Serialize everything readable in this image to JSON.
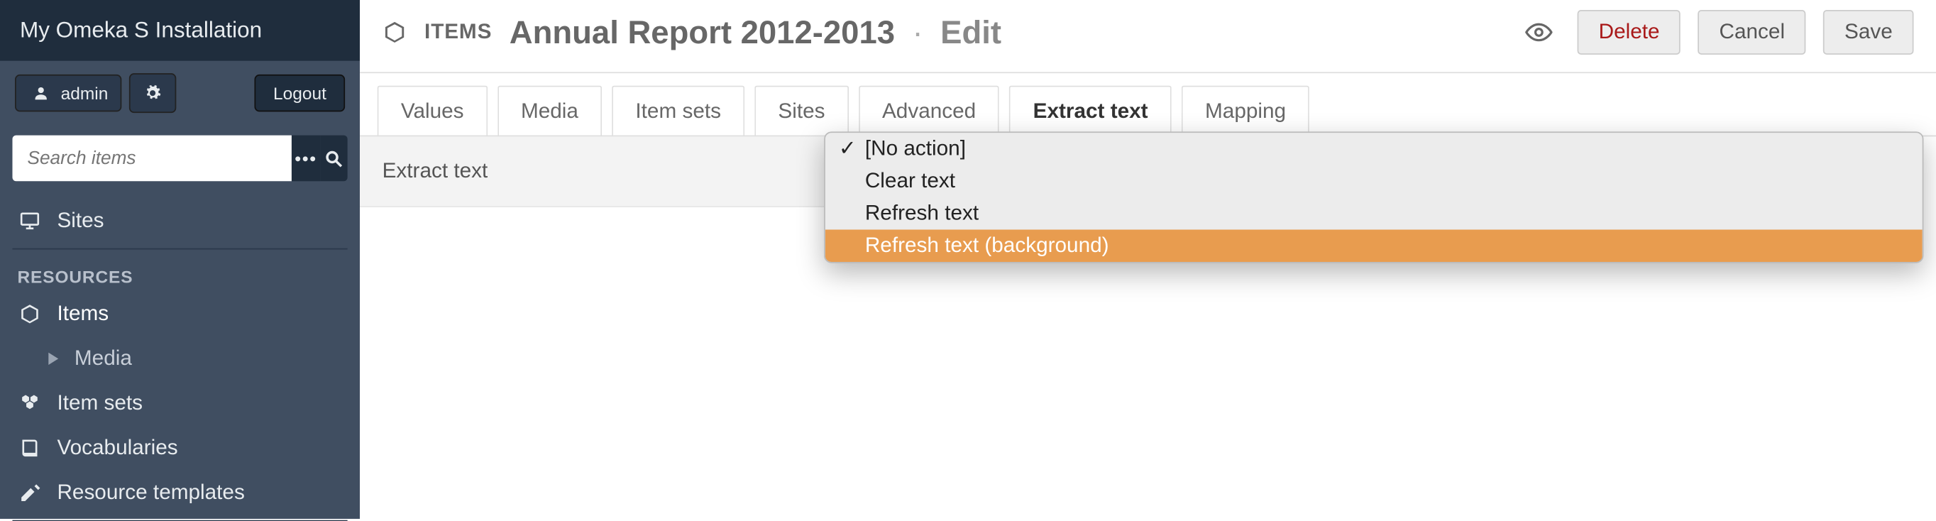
{
  "install_name": "My Omeka S Installation",
  "user": {
    "name": "admin",
    "logout_label": "Logout"
  },
  "search": {
    "placeholder": "Search items"
  },
  "nav": {
    "sites": "Sites",
    "resources_heading": "RESOURCES",
    "items": "Items",
    "media": "Media",
    "item_sets": "Item sets",
    "vocabularies": "Vocabularies",
    "resource_templates": "Resource templates"
  },
  "header": {
    "breadcrumb": "ITEMS",
    "title": "Annual Report 2012-2013",
    "sep": "·",
    "mode": "Edit",
    "delete": "Delete",
    "cancel": "Cancel",
    "save": "Save"
  },
  "tabs": [
    {
      "label": "Values"
    },
    {
      "label": "Media"
    },
    {
      "label": "Item sets"
    },
    {
      "label": "Sites"
    },
    {
      "label": "Advanced"
    },
    {
      "label": "Extract text"
    },
    {
      "label": "Mapping"
    }
  ],
  "active_tab": 5,
  "form": {
    "extract_label": "Extract text"
  },
  "dropdown": {
    "items": [
      {
        "label": "[No action]",
        "selected": true
      },
      {
        "label": "Clear text",
        "selected": false
      },
      {
        "label": "Refresh text",
        "selected": false
      },
      {
        "label": "Refresh text (background)",
        "selected": false
      }
    ],
    "hover_index": 3
  }
}
